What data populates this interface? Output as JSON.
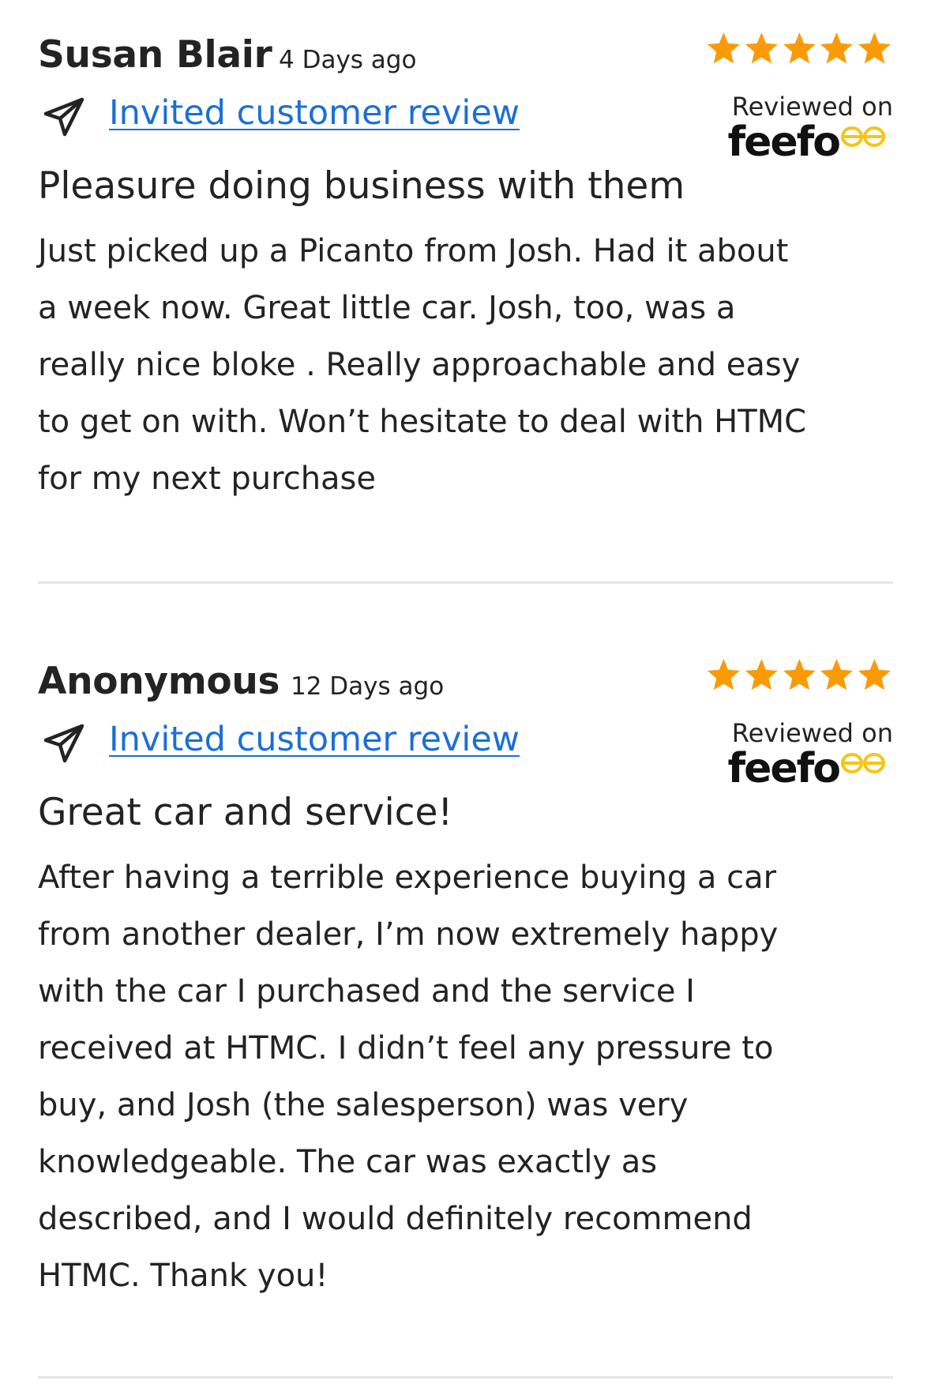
{
  "colors": {
    "star": "#fa9b05",
    "link": "#1a6fd8",
    "text": "#232323",
    "divider": "#e4e4e4",
    "feefo_eyes": "#f5c518"
  },
  "icons": {
    "invite": "paper-plane-icon",
    "star": "star-icon",
    "brand": "feefo-logo"
  },
  "reviews": [
    {
      "author": "Susan Blair",
      "date": "4 Days ago",
      "invite_label": "Invited customer review",
      "rating": 5,
      "reviewed_on": "Reviewed on",
      "brand": "feefo",
      "title": "Pleasure doing business with them",
      "body_lines": [
        "Just picked up a Picanto from Josh. Had it about",
        "a week now. Great little car. Josh, too, was a",
        "really nice bloke . Really approachable and easy",
        "to get on with. Won’t hesitate to deal with HTMC",
        "for my next purchase"
      ]
    },
    {
      "author": "Anonymous",
      "date": "12 Days ago",
      "invite_label": "Invited customer review",
      "rating": 5,
      "reviewed_on": "Reviewed on",
      "brand": "feefo",
      "title": "Great car and service!",
      "body_lines": [
        "After having a terrible experience buying a car",
        "from another dealer, I’m now extremely happy",
        "with the car I purchased and the service I",
        "received at HTMC. I didn’t feel any pressure to",
        "buy, and Josh (the salesperson) was very",
        "knowledgeable. The car was exactly as",
        "described, and I would definitely recommend",
        "HTMC. Thank you!"
      ]
    }
  ]
}
